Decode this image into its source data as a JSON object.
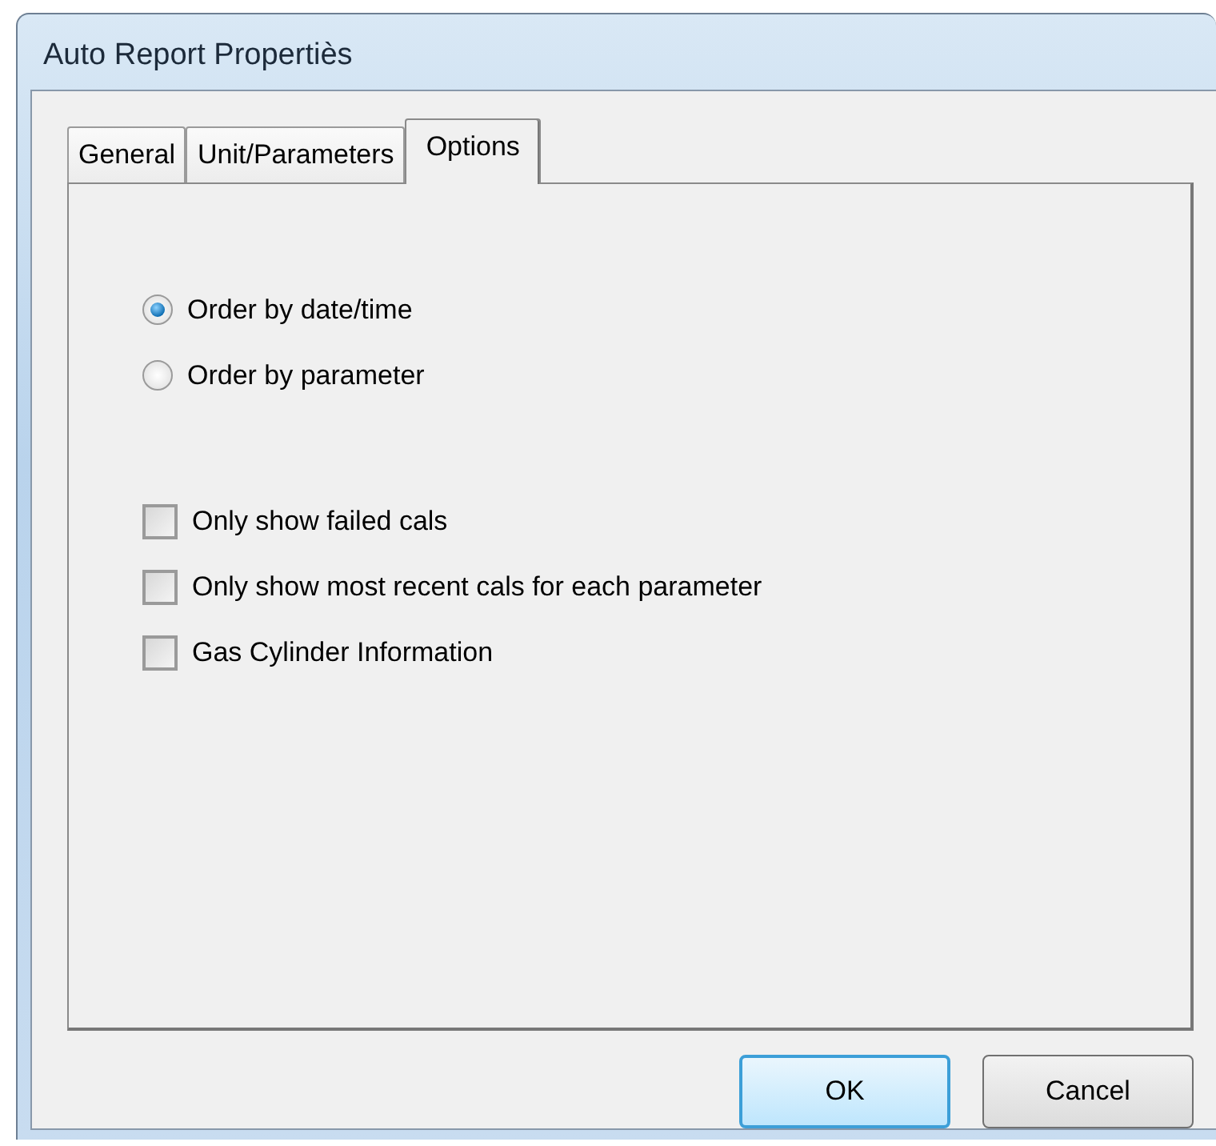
{
  "window": {
    "title": "Auto Report Propertiès"
  },
  "tabs": [
    {
      "label": "General",
      "selected": false
    },
    {
      "label": "Unit/Parameters",
      "selected": false
    },
    {
      "label": "Options",
      "selected": true
    }
  ],
  "options": [
    {
      "kind": "radio",
      "label": "Order by date/time",
      "selected": true
    },
    {
      "kind": "radio",
      "label": "Order by parameter",
      "selected": false
    },
    {
      "kind": "gap"
    },
    {
      "kind": "checkbox",
      "label": "Only show failed cals",
      "checked": false
    },
    {
      "kind": "checkbox",
      "label": "Only show most recent cals for each parameter",
      "checked": false
    },
    {
      "kind": "checkbox",
      "label": "Gas Cylinder Information",
      "checked": false
    }
  ],
  "buttons": [
    {
      "label": "OK",
      "default": true
    },
    {
      "label": "Cancel",
      "default": false
    }
  ]
}
